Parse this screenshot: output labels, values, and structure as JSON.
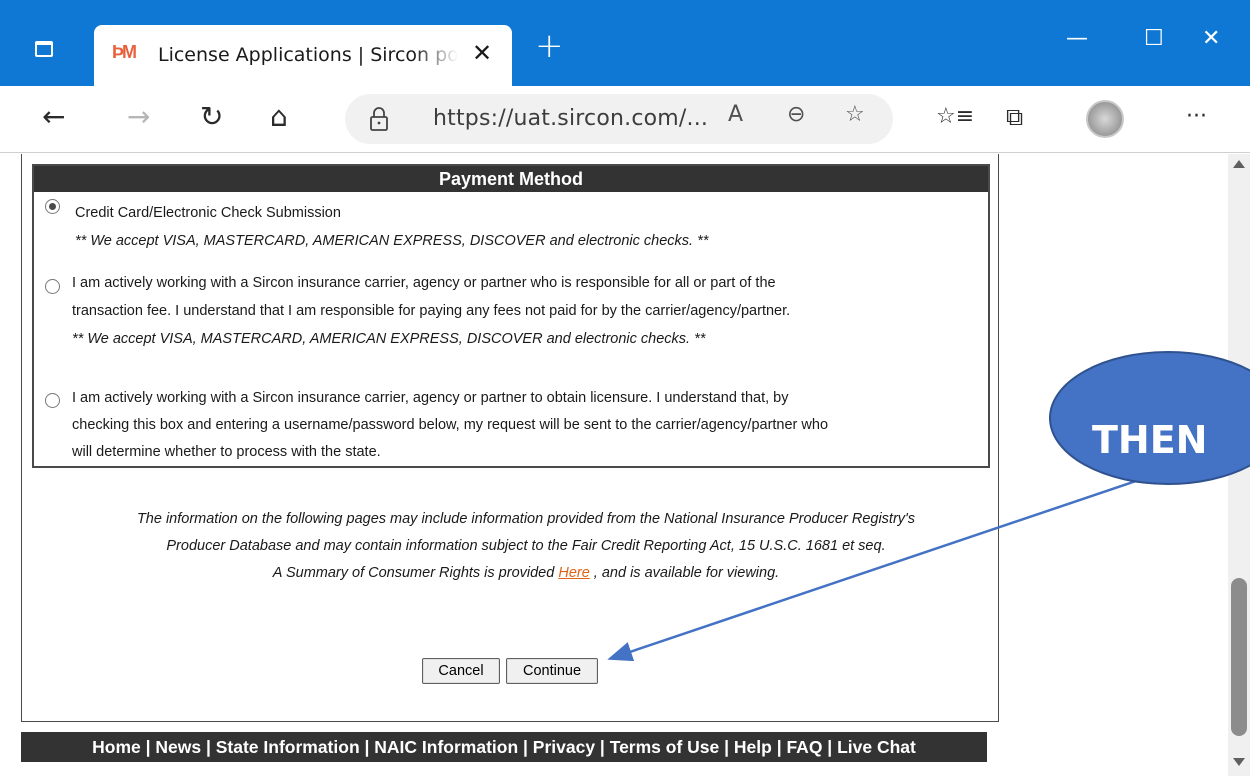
{
  "browser": {
    "tab_title": "License Applications | Sircon powered by Vertafore",
    "tab_favicon": "ÞM",
    "close_glyph": "✕",
    "new_tab_glyph": "+",
    "url": "https://uat.sircon.com/...",
    "read_aloud_glyph": "A",
    "minimize_glyph": "—",
    "maximize_glyph": "☐",
    "window_close_glyph": "✕",
    "back_glyph": "←",
    "forward_glyph": "→",
    "refresh_glyph": "↻",
    "home_glyph": "⌂",
    "zoom_glyph": "⊖",
    "add_favorite_glyph": "☆",
    "favorites_glyph": "☆≡",
    "collections_glyph": "⧉",
    "more_glyph": "···",
    "icons": [
      "tab-actions-icon",
      "back-icon",
      "forward-icon",
      "refresh-icon",
      "home-icon",
      "lock-icon",
      "read-aloud-icon",
      "zoom-icon",
      "add-favorite-icon",
      "favorites-icon",
      "collections-icon",
      "profile-icon",
      "more-icon"
    ]
  },
  "payment": {
    "header": "Payment Method",
    "options": [
      {
        "selected": true,
        "lines": [
          "Credit Card/Electronic Check Submission"
        ],
        "note": "** We accept VISA, MASTERCARD, AMERICAN EXPRESS, DISCOVER and electronic checks. **"
      },
      {
        "selected": false,
        "lines": [
          "I am actively working with a Sircon insurance carrier, agency or partner who is responsible for all or part of the",
          "transaction fee. I understand that I am responsible for paying any fees not paid for by the carrier/agency/partner."
        ],
        "note": "** We accept VISA, MASTERCARD, AMERICAN EXPRESS, DISCOVER and electronic checks. **"
      },
      {
        "selected": false,
        "lines": [
          "I am actively working with a Sircon insurance carrier, agency or partner to obtain licensure. I understand that, by",
          "checking this box and entering a username/password below, my request will be sent to the carrier/agency/partner who",
          "will determine whether to process with the state."
        ]
      }
    ]
  },
  "disclaimer": {
    "line1": "The information on the following pages may include information provided from the National Insurance Producer Registry's",
    "line2": "Producer Database and may contain information subject to the Fair Credit Reporting Act, 15 U.S.C. 1681 et seq.",
    "line3_before": "A Summary of Consumer Rights is provided ",
    "link": "Here",
    "line3_after": " , and is available for viewing."
  },
  "buttons": {
    "cancel": "Cancel",
    "continue": "Continue"
  },
  "footer": {
    "links": [
      "Home",
      "News",
      "State Information",
      "NAIC Information",
      "Privacy",
      "Terms of Use",
      "Help",
      "FAQ",
      "Live Chat"
    ],
    "separator": " | "
  },
  "annotation": {
    "callout_text": "THEN",
    "callout_color": "#4472c4",
    "arrow_color": "#4472c4"
  }
}
